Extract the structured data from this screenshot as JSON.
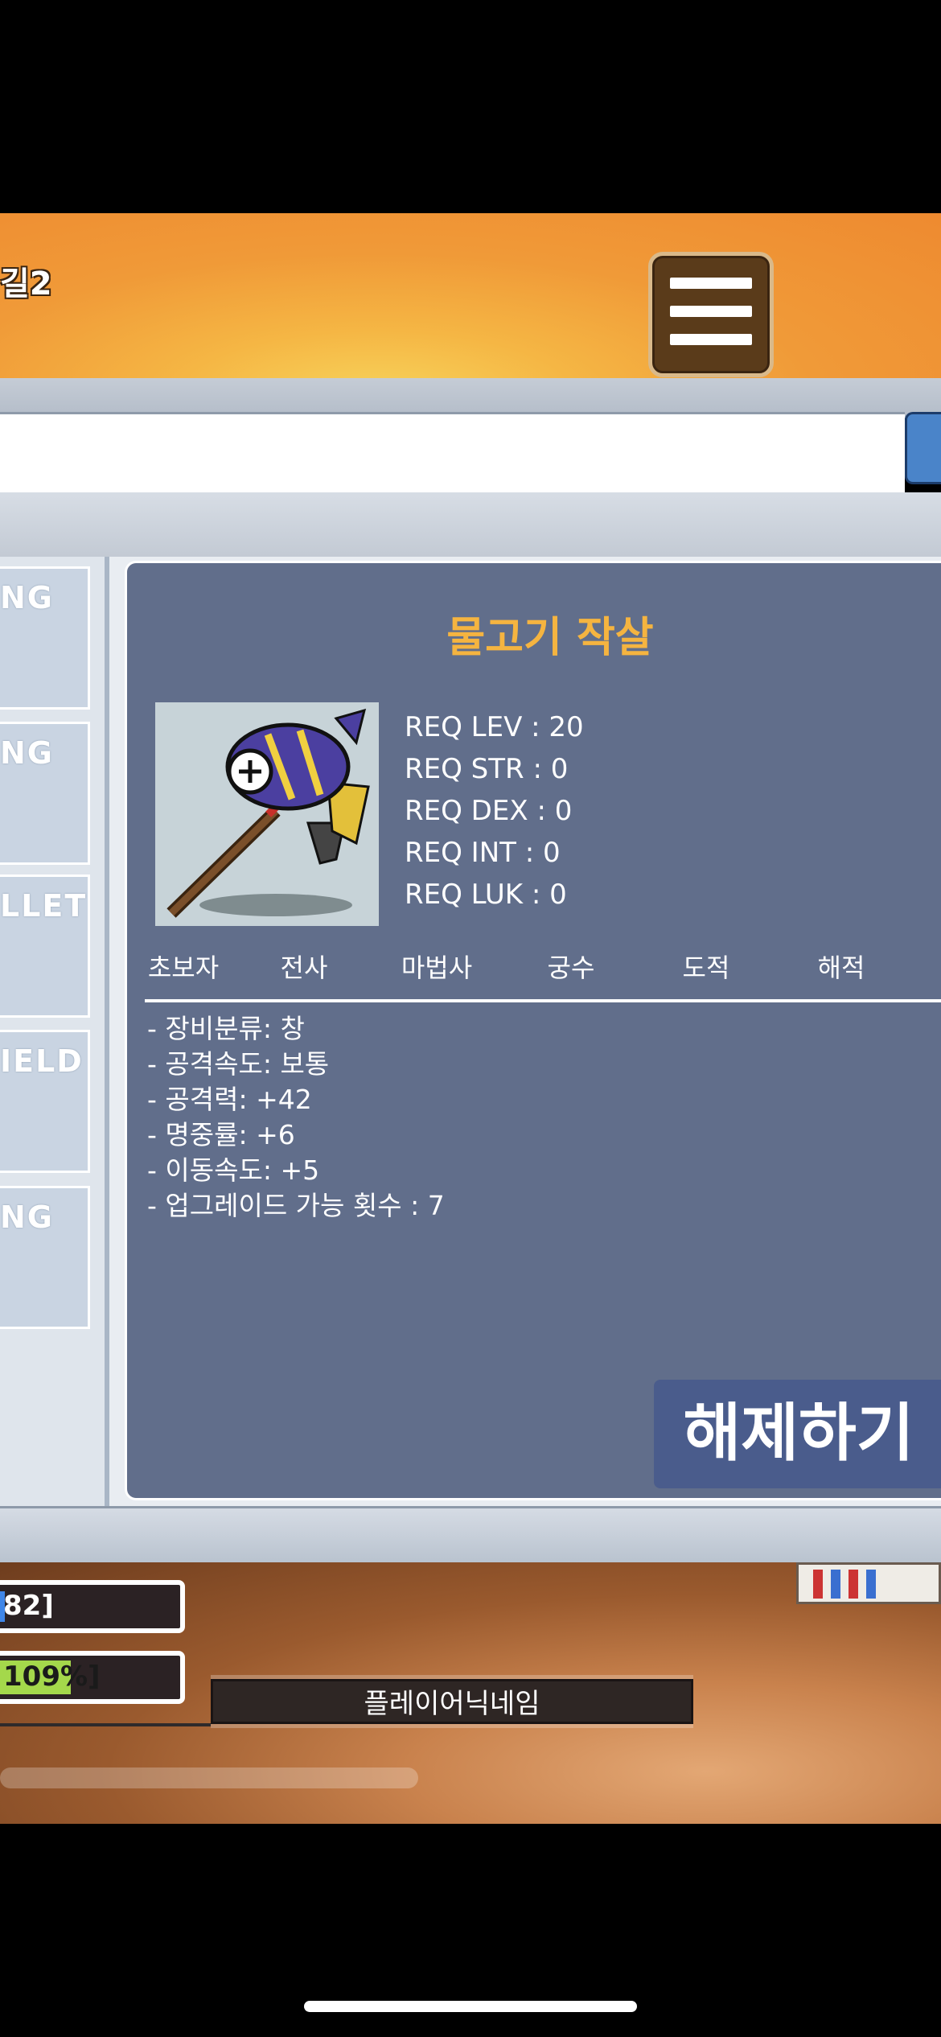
{
  "header": {
    "title": "길2"
  },
  "list": [
    {
      "label": "NG"
    },
    {
      "label": "NG"
    },
    {
      "label": "LLET"
    },
    {
      "label": "IELD"
    },
    {
      "label": "NG"
    }
  ],
  "item": {
    "name": "물고기 작살",
    "requirements": [
      "REQ LEV : 20",
      "REQ STR : 0",
      "REQ DEX : 0",
      "REQ INT : 0",
      "REQ LUK : 0"
    ],
    "jobs": [
      "초보자",
      "전사",
      "마법사",
      "궁수",
      "도적",
      "해적"
    ],
    "stats": [
      "- 장비분류: 창",
      "- 공격속도: 보통",
      "- 공격력: +42",
      "- 명중률: +6",
      "- 이동속도: +5",
      "- 업그레이드 가능 횟수 : 7"
    ]
  },
  "actions": {
    "unequip_label": "해제하기"
  },
  "hud": {
    "hp_text": "82]",
    "exp_text": "109%]",
    "nickname": "플레이어닉네임"
  },
  "colors": {
    "panel": "#616e8b",
    "item_name": "#f5b440",
    "unequip_button": "#4a5c8c",
    "header": "#ee8a30"
  }
}
